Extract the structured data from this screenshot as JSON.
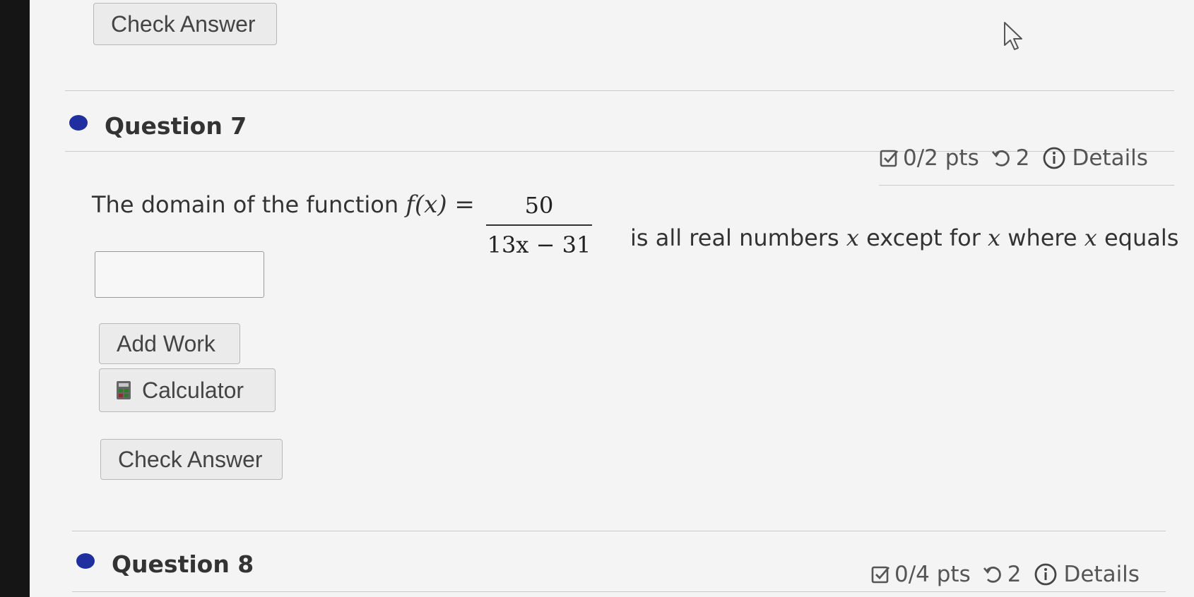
{
  "top": {
    "check_answer_label": "Check Answer"
  },
  "question7": {
    "title": "Question 7",
    "points": "0/2 pts",
    "attempts": "2",
    "details": "Details",
    "prompt_prefix": "The domain of the function",
    "function_lhs": "f(x) =",
    "numerator": "50",
    "denominator": "13x − 31",
    "prompt_suffix_1": "is all real numbers",
    "variable": "x",
    "prompt_suffix_2": "except for",
    "prompt_suffix_3": "where",
    "prompt_suffix_4": "equals",
    "answer_value": "",
    "add_work_label": "Add Work",
    "calculator_label": "Calculator",
    "check_answer_label": "Check Answer"
  },
  "question8": {
    "title": "Question 8",
    "points": "0/4 pts",
    "attempts": "2",
    "details": "Details"
  },
  "icons": {
    "dot": "question-bullet-icon",
    "points": "checkbox-edit-icon",
    "attempts": "retry-icon",
    "details": "info-icon",
    "calculator": "calculator-icon",
    "cursor": "mouse-pointer-icon"
  },
  "colors": {
    "bullet": "#1f2fa0",
    "text": "#333333",
    "button_bg": "#ebebeb"
  }
}
